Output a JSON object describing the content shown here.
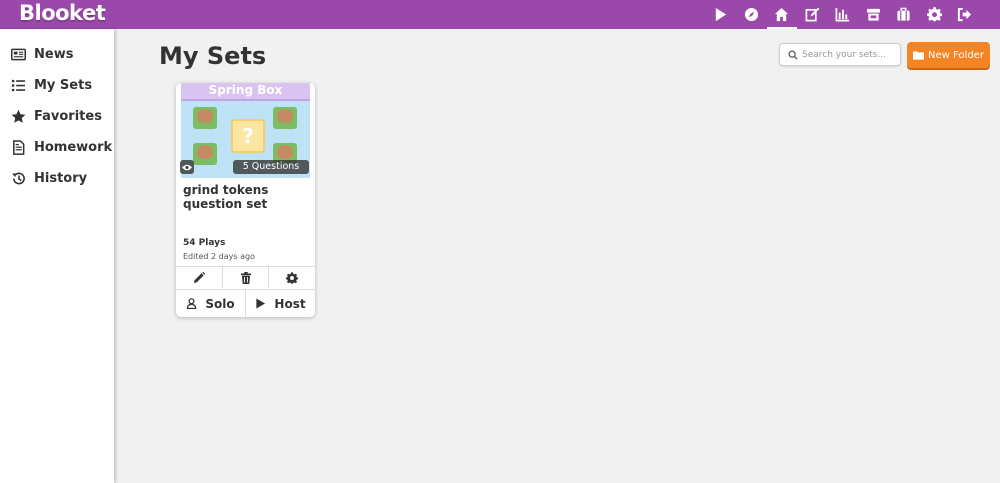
{
  "app": {
    "logo": "Blooket"
  },
  "topnav": {
    "items": [
      {
        "icon": "play-icon"
      },
      {
        "icon": "compass-icon"
      },
      {
        "icon": "home-icon",
        "active": true
      },
      {
        "icon": "edit-icon"
      },
      {
        "icon": "stats-icon"
      },
      {
        "icon": "market-icon"
      },
      {
        "icon": "blooks-icon"
      },
      {
        "icon": "settings-icon"
      },
      {
        "icon": "logout-icon"
      }
    ]
  },
  "sidebar": {
    "items": [
      {
        "label": "News",
        "icon": "newspaper-icon"
      },
      {
        "label": "My Sets",
        "icon": "list-icon"
      },
      {
        "label": "Favorites",
        "icon": "star-icon"
      },
      {
        "label": "Homework",
        "icon": "document-icon"
      },
      {
        "label": "History",
        "icon": "history-icon"
      }
    ]
  },
  "main": {
    "title": "My Sets",
    "search": {
      "placeholder": "Search your sets...",
      "value": ""
    },
    "new_folder_label": "New Folder"
  },
  "sets": [
    {
      "cover_banner": "Spring Box",
      "question_count": "5 Questions",
      "title": "grind tokens question set",
      "plays": "54 Plays",
      "edited": "Edited 2 days ago",
      "solo_label": "Solo",
      "host_label": "Host"
    }
  ],
  "colors": {
    "topbar": "#9a49aa",
    "new_folder": "#f58524",
    "sidebar": "#ffffff",
    "background": "#f1f1f1"
  }
}
